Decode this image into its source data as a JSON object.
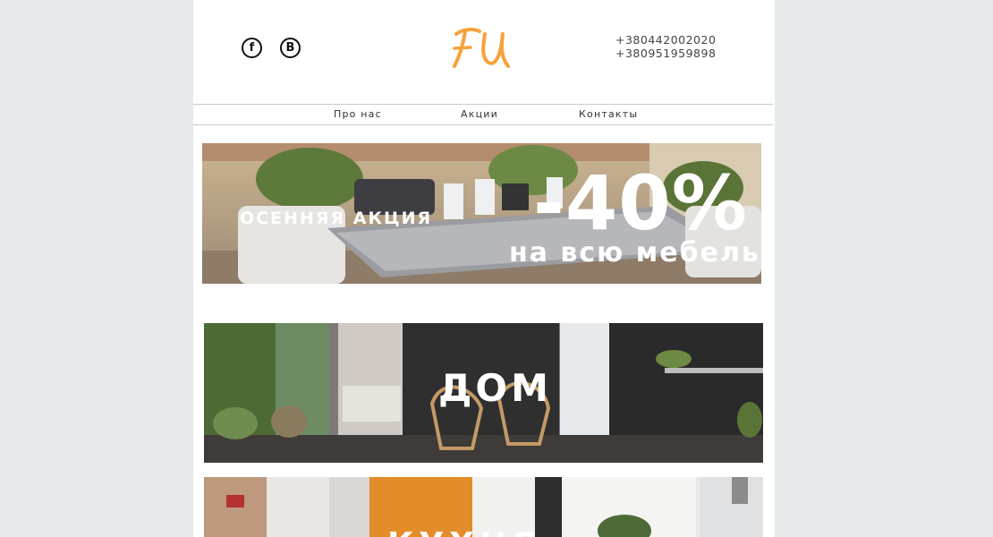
{
  "header": {
    "social": [
      {
        "name": "facebook",
        "glyph": "f"
      },
      {
        "name": "vk",
        "glyph": "B"
      }
    ],
    "logo_text": "FU",
    "phones": [
      "+380442002020",
      "+380951959898"
    ]
  },
  "nav": {
    "items": [
      {
        "label": "Про  нас"
      },
      {
        "label": "Акции"
      },
      {
        "label": "Контакты"
      }
    ]
  },
  "banners": {
    "promo": {
      "subtitle": "ОСЕННЯЯ АКЦИЯ",
      "discount": "-40%",
      "caption": "на всю мебель"
    },
    "home": {
      "title": "ДОМ"
    },
    "third": {
      "title": "КУХНЯ"
    }
  },
  "colors": {
    "logo": "#f6a23a",
    "background": "#e7eaea",
    "page": "#ffffff"
  }
}
